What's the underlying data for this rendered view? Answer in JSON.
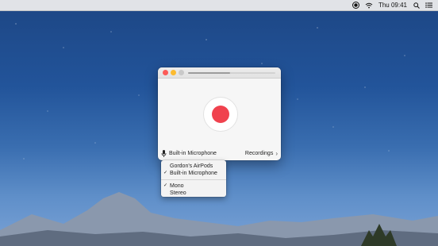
{
  "menubar": {
    "time": "Thu 09:41",
    "icons": [
      "record-indicator-icon",
      "wifi-icon",
      "search-icon",
      "list-icon"
    ]
  },
  "window": {
    "progress": 0.48,
    "record_button": "record-icon",
    "input_label": "Built-in Microphone",
    "recordings_label": "Recordings",
    "recordings_chevron": "›"
  },
  "dropdown": {
    "devices": [
      {
        "label": "Gordon's AirPods",
        "checked": false
      },
      {
        "label": "Built-in Microphone",
        "checked": true
      }
    ],
    "channels": [
      {
        "label": "Mono",
        "checked": true
      },
      {
        "label": "Stereo",
        "checked": false
      }
    ],
    "check_glyph": "✓"
  },
  "colors": {
    "record": "#f0424e",
    "traffic_close": "#fc5b57",
    "traffic_min": "#fcbb30",
    "traffic_max": "#c9c9c9"
  }
}
